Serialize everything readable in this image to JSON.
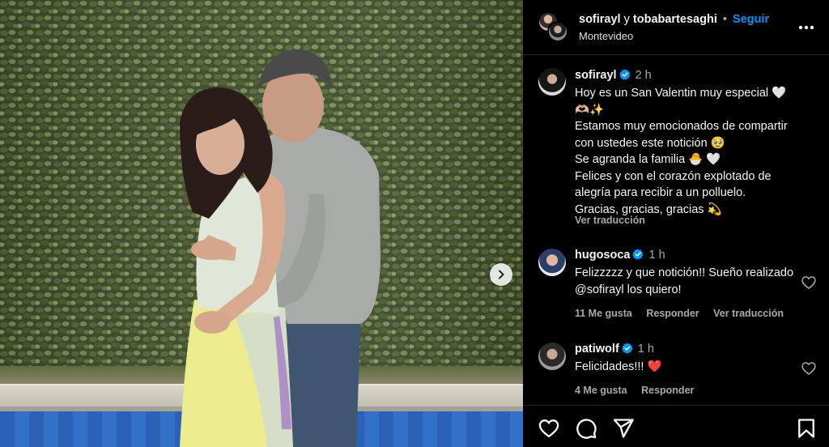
{
  "header": {
    "user1": "sofirayl",
    "conjunction": "y",
    "user2": "tobabartesaghi",
    "separator": "•",
    "follow_label": "Seguir",
    "location": "Montevideo"
  },
  "caption": {
    "username": "sofirayl",
    "time": "2 h",
    "lines": [
      "Hoy es un San Valentin muy especial 🤍",
      "🫶🏼✨",
      "Estamos muy emocionados de compartir con ustedes este notición 🥹",
      "Se agranda la familia 🐣 🤍",
      "Felices y con el corazón explotado de alegría para recibir a un polluelo.",
      "Gracias, gracias, gracias 💫"
    ],
    "translate_label": "Ver traducción"
  },
  "comments": [
    {
      "username": "hugosoca",
      "time": "1 h",
      "text": "Felizzzzz y que notición!! Sueño realizado @sofirayl los quiero!",
      "likes": "11 Me gusta",
      "reply_label": "Responder",
      "translate_label": "Ver traducción"
    },
    {
      "username": "patiwolf",
      "time": "1 h",
      "text": "Felicidades!!! ❤️",
      "likes": "4 Me gusta",
      "reply_label": "Responder"
    }
  ],
  "icons": {
    "more": "more-options-icon",
    "verified": "verified-badge-icon",
    "like": "heart-icon",
    "comment": "comment-icon",
    "share": "send-icon",
    "save": "bookmark-icon",
    "next": "chevron-right-icon"
  },
  "colors": {
    "accent": "#0095f6",
    "background": "#000000",
    "secondary_text": "#a8a8a8",
    "heart_red": "#ff3040"
  }
}
